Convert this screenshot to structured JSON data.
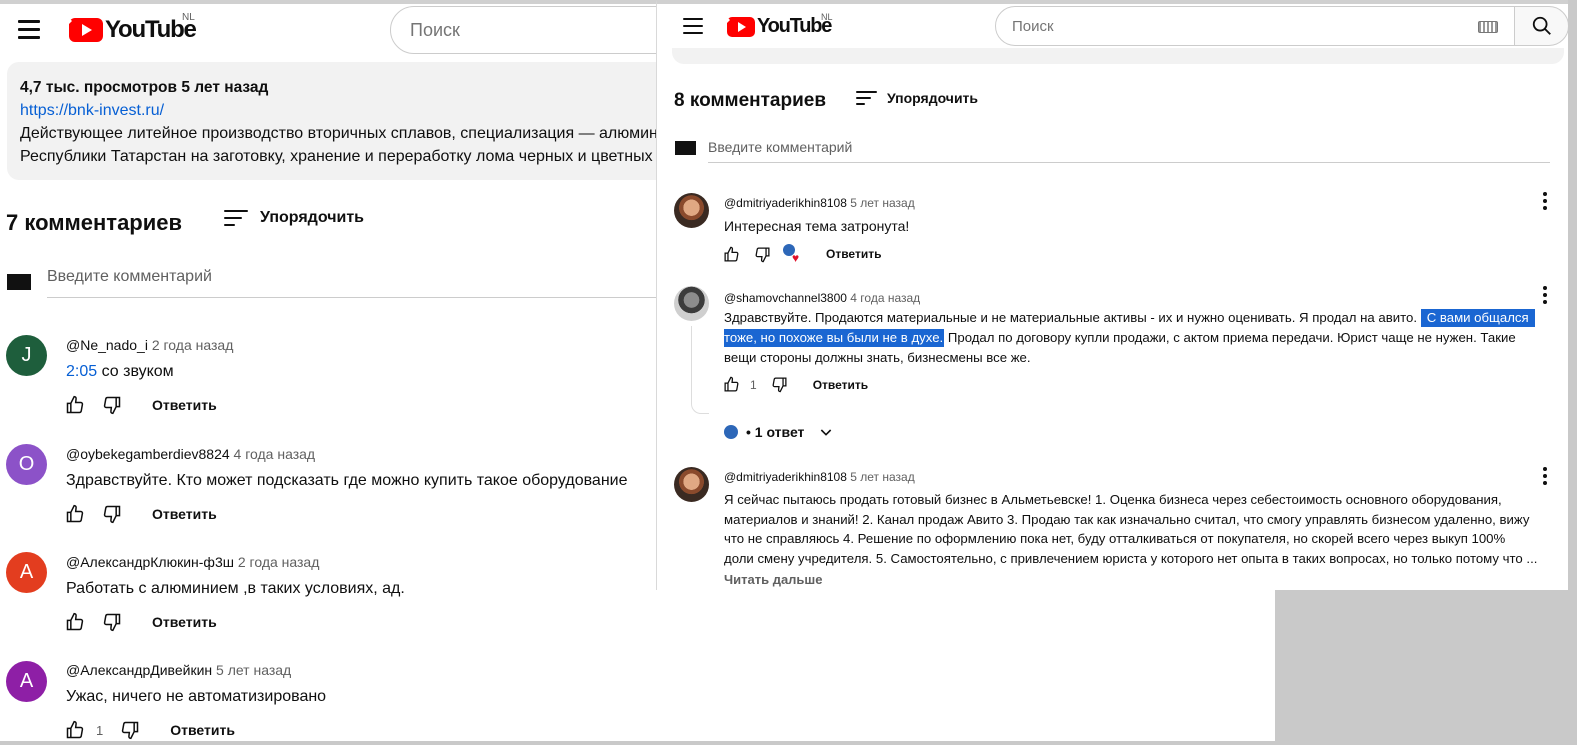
{
  "left": {
    "logo_text": "YouTube",
    "region": "NL",
    "search_placeholder": "Поиск",
    "description": {
      "meta": "4,7 тыс. просмотров  5 лет назад",
      "link": "https://bnk-invest.ru/",
      "line1": "Действующее литейное производство вторичных сплавов, специализация — алюминий",
      "line2": "Республики Татарстан на заготовку, хранение и переработку лома черных и цветных"
    },
    "comments_count": "7 комментариев",
    "sort_label": "Упорядочить",
    "add_comment_placeholder": "Введите комментарий",
    "comments": [
      {
        "avatar_letter": "J",
        "avatar_color": "#1e5e3c",
        "author": "@Ne_nado_i",
        "time": "2 года назад",
        "timestamp_link": "2:05",
        "text": " со звуком",
        "likes": "",
        "reply": "Ответить"
      },
      {
        "avatar_letter": "O",
        "avatar_color": "#8c52c8",
        "author": "@oybekegamberdiev8824",
        "time": "4 года назад",
        "text": "Здравствуйте. Кто может подсказать где можно купить такое оборудование",
        "likes": "",
        "reply": "Ответить"
      },
      {
        "avatar_letter": "А",
        "avatar_color": "#e33d1f",
        "author": "@АлександрКлюкин-ф3ш",
        "time": "2 года назад",
        "text": "Работать с алюминием ,в таких условиях, ад.",
        "likes": "",
        "reply": "Ответить"
      },
      {
        "avatar_letter": "А",
        "avatar_color": "#8e1fa6",
        "author": "@АлександрДивейкин",
        "time": "5 лет назад",
        "text": "Ужас, ничего не автоматизировано",
        "likes": "1",
        "reply": "Ответить"
      }
    ]
  },
  "right": {
    "logo_text": "YouTube",
    "region": "NL",
    "search_placeholder": "Поиск",
    "comments_count": "8 комментариев",
    "sort_label": "Упорядочить",
    "add_comment_placeholder": "Введите комментарий",
    "comments": [
      {
        "author": "@dmitriyaderikhin8108",
        "time": "5 лет назад",
        "text": "Интересная тема затронута!",
        "reply": "Ответить"
      },
      {
        "author": "@shamovchannel3800",
        "time": "4 года назад",
        "text_before": "Здравствуйте. Продаются материальные и не материальные активы - их и нужно оценивать. Я продал на авито. ",
        "text_hl1": "С вами общался",
        "text_hl2": "тоже, но похоже вы были не в духе.",
        "text_after2": " Продал по договору купли продажи, с актом приема передачи. Юрист чаще не  нужен. Такие",
        "text_line3": "вещи стороны должны знать, бизнесмены все же.",
        "likes": "1",
        "reply": "Ответить",
        "replies": "• 1 ответ"
      },
      {
        "author": "@dmitriyaderikhin8108",
        "time": "5 лет назад",
        "lines": [
          "Я сейчас пытаюсь продать готовый бизнес в Альметьевске! 1. Оценка бизнеса через себестоимость основного оборудования,",
          "материалов и знаний! 2. Канал продаж Авито 3. Продаю так как изначально считал, что смогу управлять бизнесом удаленно, вижу",
          "что не справляюсь 4. Решение по оформлению пока нет, буду отталкиваться от покупателя, но скорей всего через выкуп 100%",
          "доли смену учредителя. 5. Самостоятельно, с привлечением юриста у которого нет опыта в таких вопросах, но только потому что ..."
        ],
        "read_more": "Читать дальше"
      }
    ]
  }
}
